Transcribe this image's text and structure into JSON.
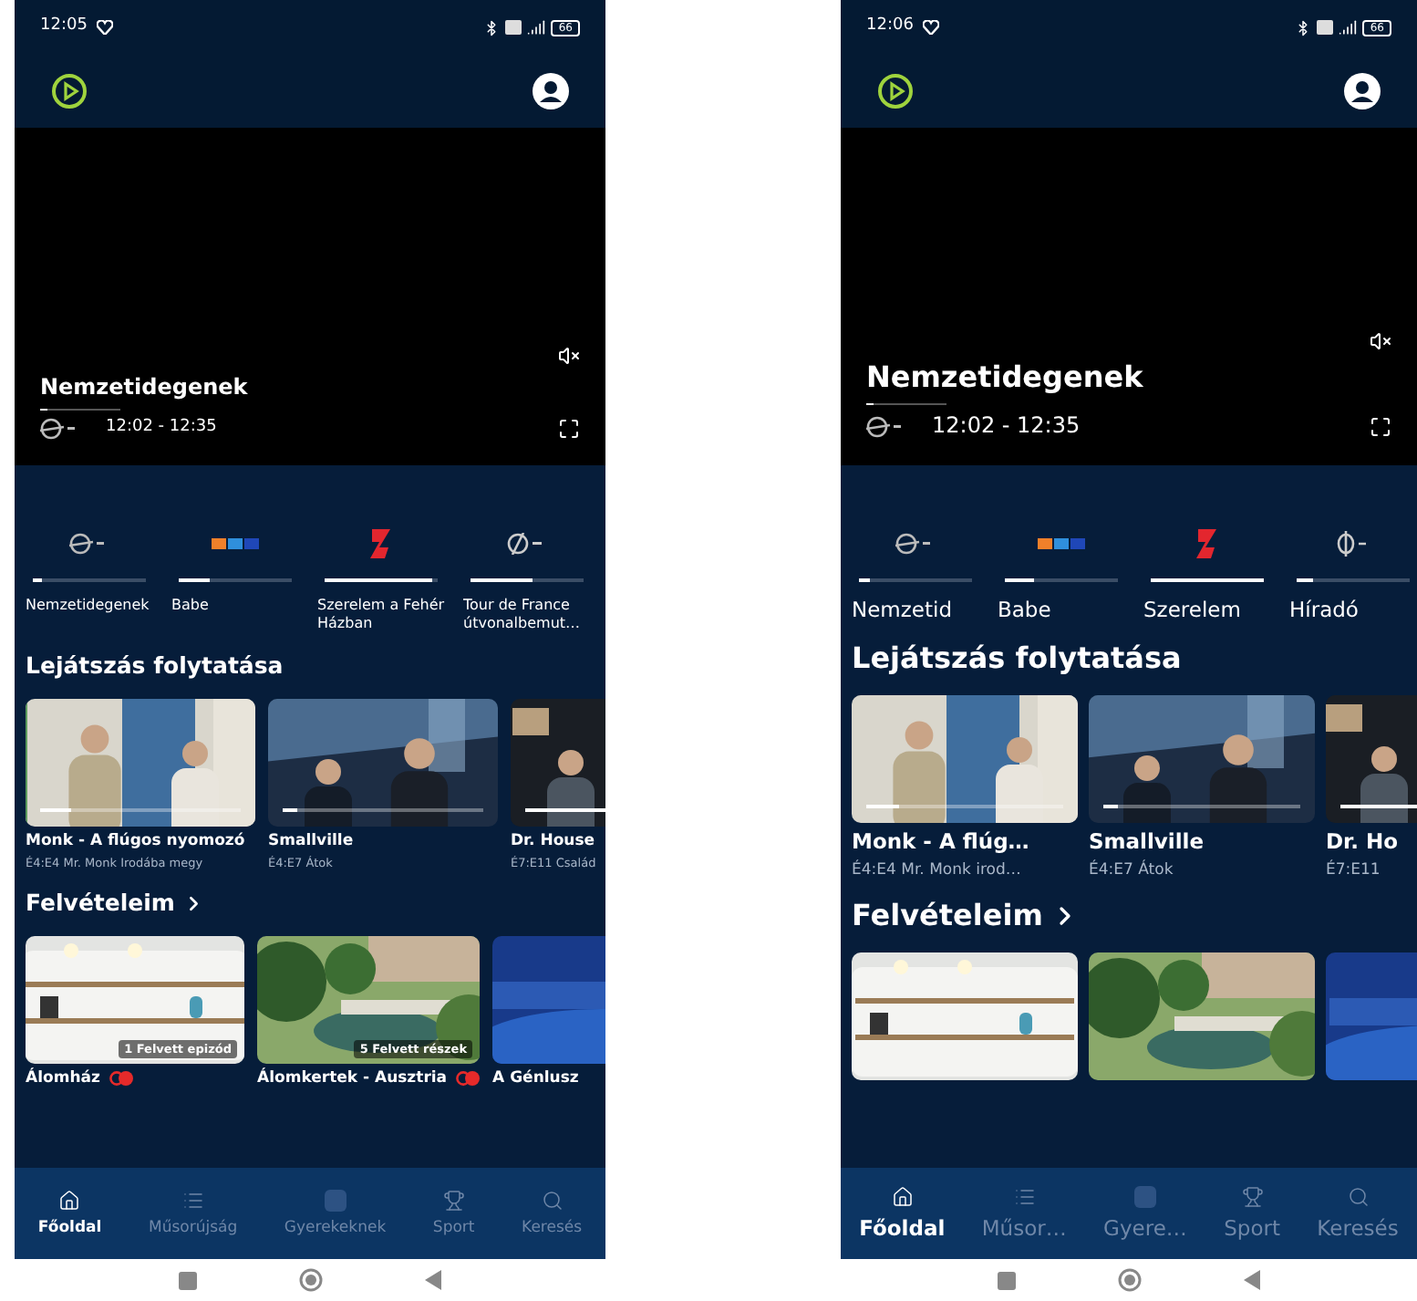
{
  "phones": [
    {
      "kind": "normal",
      "status_bar": {
        "time": "12:05",
        "battery": "66"
      },
      "player": {
        "title": "Nemzetidegenek",
        "level": 0.1,
        "time_range": "12:02 - 12:35",
        "muted": true
      },
      "channels": [
        {
          "kind": "globe",
          "name": "Nemzetidegenek",
          "level": 0.08
        },
        {
          "kind": "blocks",
          "name": "Babe",
          "level": 0.28
        },
        {
          "kind": "numeral",
          "name": "Szerelem a Fehér Házban",
          "level": 0.95
        },
        {
          "kind": "crossed-globe",
          "name": "Tour de France útvonalbemut…",
          "level": 0.55
        }
      ],
      "continue_watching": {
        "title": "Lejátszás folytatása",
        "items": [
          {
            "kind": "picture",
            "title": "Monk - A flúgos nyomozó",
            "episode": "É4:E4 Mr. Monk Irodába megy",
            "level": 0.15
          },
          {
            "kind": "picture",
            "title": "Smallville",
            "episode": "É4:E7 Átok",
            "level": 0.07
          },
          {
            "kind": "picture",
            "title": "Dr. House",
            "episode": "É7:E11 Család",
            "level": 0.6
          }
        ]
      },
      "recordings": {
        "title": "Felvételeim",
        "items": [
          {
            "kind": "picture",
            "title": "Álomház",
            "badge": "1 Felvett epizód",
            "recording": true
          },
          {
            "kind": "picture",
            "title": "Álomkertek - Ausztria",
            "badge": "5 Felvett részek",
            "recording": true
          },
          {
            "kind": "picture",
            "title": "A Génlusz",
            "recording": false
          }
        ]
      },
      "nav": [
        {
          "kind": "home",
          "label": "Főoldal",
          "selected": true
        },
        {
          "kind": "list",
          "label": "Műsorújság",
          "selected": false
        },
        {
          "kind": "square",
          "label": "Gyerekeknek",
          "selected": false
        },
        {
          "kind": "trophy",
          "label": "Sport",
          "selected": false
        },
        {
          "kind": "search",
          "label": "Keresés",
          "selected": false
        }
      ]
    },
    {
      "kind": "large",
      "status_bar": {
        "time": "12:06",
        "battery": "66"
      },
      "player": {
        "title": "Nemzetidegenek",
        "level": 0.1,
        "time_range": "12:02 - 12:35",
        "muted": true
      },
      "channels": [
        {
          "kind": "globe",
          "name": "Nemzetid",
          "level": 0.1
        },
        {
          "kind": "blocks",
          "name": "Babe",
          "level": 0.25
        },
        {
          "kind": "numeral",
          "name": "Szerelem",
          "level": 1
        },
        {
          "kind": "phi",
          "name": "Híradó",
          "level": 0.15
        }
      ],
      "continue_watching": {
        "title": "Lejátszás folytatása",
        "items": [
          {
            "kind": "picture",
            "title": "Monk - A flúg…",
            "episode": "É4:E4 Mr. Monk irod…",
            "level": 0.17
          },
          {
            "kind": "picture",
            "title": "Smallville",
            "episode": "É4:E7 Átok",
            "level": 0.07
          },
          {
            "kind": "picture",
            "title": "Dr. Ho",
            "episode": "É7:E11",
            "level": 0.6
          }
        ]
      },
      "recordings": {
        "title": "Felvételeim"
      },
      "nav": [
        {
          "kind": "home",
          "label": "Főoldal",
          "selected": true
        },
        {
          "kind": "list",
          "label": "Műsor…",
          "selected": false
        },
        {
          "kind": "square",
          "label": "Gyere…",
          "selected": false
        },
        {
          "kind": "trophy",
          "label": "Sport",
          "selected": false
        },
        {
          "kind": "search",
          "label": "Keresés",
          "selected": false
        }
      ]
    }
  ]
}
